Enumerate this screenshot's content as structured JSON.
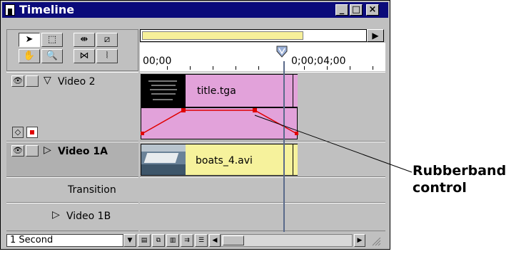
{
  "window": {
    "title": "Timeline",
    "minimize": "_",
    "maximize": "□",
    "close": "×"
  },
  "toolbar": {
    "tools": [
      "selection",
      "range",
      "ripple",
      "razor",
      "hand",
      "zoom",
      "cross-fade",
      "edit-line"
    ]
  },
  "navigator": {
    "end_arrow": "▶"
  },
  "ruler": {
    "start_time": "00;00",
    "marker_time": "0;00;04;00"
  },
  "tracks": [
    {
      "name": "Video 2",
      "expanded": true,
      "clip": "title.tga",
      "clip_color": "#e2a2da"
    },
    {
      "name": "Video 1A",
      "expanded": false,
      "clip": "boats_4.avi",
      "clip_color": "#f6f29c"
    },
    {
      "name": "Transition"
    },
    {
      "name": "Video 1B",
      "expanded": false
    }
  ],
  "statusbar": {
    "time_scale": "1 Second"
  },
  "callout": {
    "line1": "Rubberband",
    "line2": "control"
  },
  "colors": {
    "titlebar": "#0b0b7a",
    "rubberband": "#e00000",
    "edit_line": "#5a6a8a"
  }
}
